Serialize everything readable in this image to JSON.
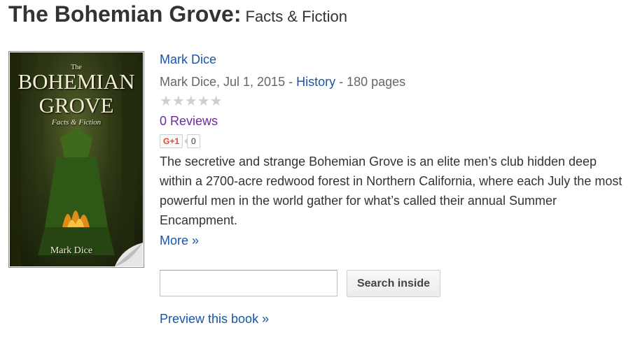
{
  "header": {
    "title": "The Bohemian Grove:",
    "subtitle": "Facts & Fiction"
  },
  "cover": {
    "line_the": "The",
    "line1": "BOHEMIAN",
    "line2": "GROVE",
    "line3": "Facts & Fiction",
    "author": "Mark Dice"
  },
  "book": {
    "author_link": "Mark Dice",
    "meta_prefix": "Mark Dice, Jul 1, 2015 - ",
    "category": "History",
    "meta_suffix": " - 180 pages",
    "stars": "★★★★★",
    "rating": 0,
    "reviews": "0 Reviews",
    "gplus_label": "G+1",
    "gplus_count": "0",
    "description": " The secretive and strange Bohemian Grove is an elite men’s club hidden deep within a 2700-acre redwood forest in Northern California, where each July the most powerful men in the world gather for what’s called their annual Summer Encampment.",
    "more": "More »"
  },
  "search": {
    "value": "",
    "button_label": "Search inside"
  },
  "preview": "Preview this book »",
  "colors": {
    "link": "#1a55a6",
    "visited_link": "#6c2aa2",
    "meta_text": "#666666",
    "star_empty": "#cfcfcf",
    "gplus_red": "#dd4b39"
  }
}
